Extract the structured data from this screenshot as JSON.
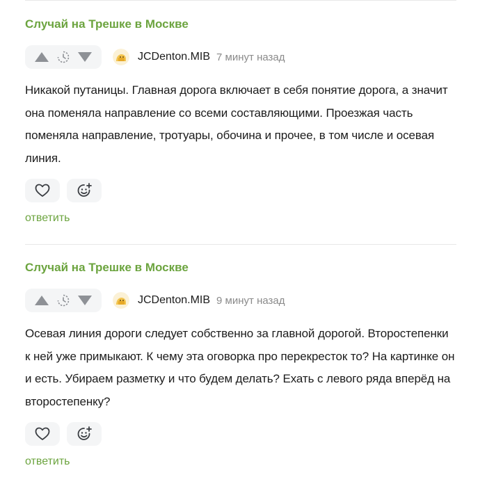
{
  "comments": [
    {
      "post_title": "Случай на Трешке в Москве",
      "author": "JCDenton.MIB",
      "time": "7 минут назад",
      "text": "Никакой путаницы. Главная дорога включает в себя понятие дорога, а значит она поменяла направление со всеми составляющими. Проезжая часть поменяла направление, тротуары, обочина и прочее, в том числе и осевая линия.",
      "reply_label": "ответить"
    },
    {
      "post_title": "Случай на Трешке в Москве",
      "author": "JCDenton.MIB",
      "time": "9 минут назад",
      "text": "Осевая линия дороги следует собственно за главной дорогой. Второстепенки к ней уже примыкают. К чему эта оговорка про перекресток то? На картинке он и есть. Убираем разметку и что будем делать? Ехать с левого ряда вперёд на второстепенку?",
      "reply_label": "ответить"
    }
  ],
  "icons": {
    "upvote": "triangle-up-icon",
    "rating_pending": "clock-dashed-icon",
    "downvote": "triangle-down-icon",
    "avatar": "avatar-cartoon-icon",
    "like": "heart-icon",
    "react": "smile-plus-icon"
  },
  "colors": {
    "accent_green": "#6ca43f",
    "vote_gray": "#8e9196",
    "panel_bg": "#f4f5f6",
    "muted_text": "#8a8a8a"
  }
}
